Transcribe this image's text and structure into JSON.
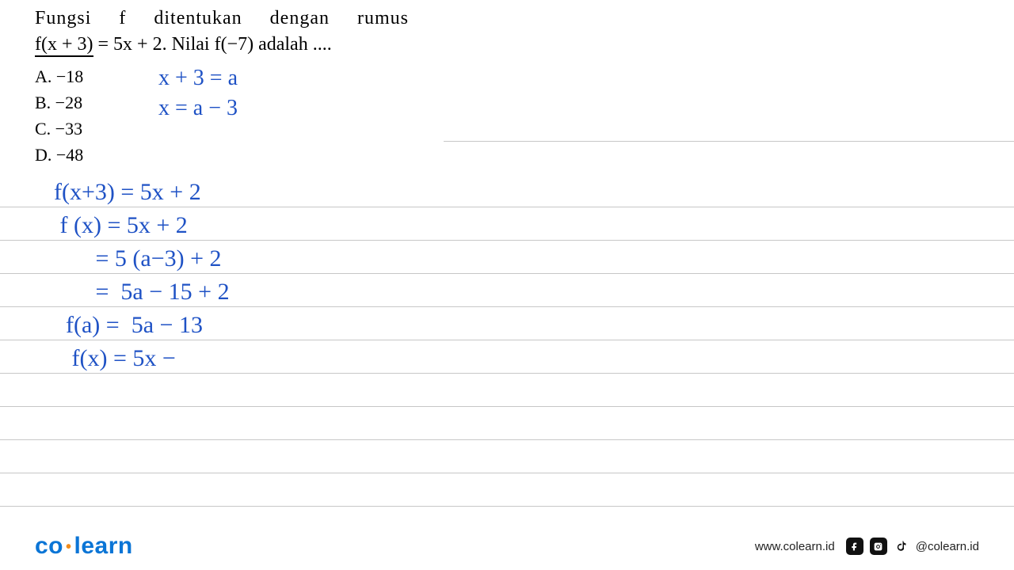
{
  "problem": {
    "line1_words": [
      "Fungsi",
      "f",
      "ditentukan",
      "dengan",
      "rumus"
    ],
    "line2_prefix": "f(x + 3)",
    "line2_rest": " = 5x + 2.  Nilai  f(−7)  adalah ....",
    "options": {
      "a": "A.  −18",
      "b": "B.  −28",
      "c": "C.  −33",
      "d": "D.  −48"
    }
  },
  "handwriting_top": {
    "l1": "x + 3 = a",
    "l2": "  x = a − 3"
  },
  "work": {
    "l1": "f(x+3) = 5x + 2",
    "l2": " f (x) = 5x + 2",
    "l3": "       = 5 (a−3) + 2",
    "l4": "       =  5a − 15 + 2",
    "l5": "  f(a) =  5a − 13",
    "l6": "   f(x) = 5x −"
  },
  "footer": {
    "brand_co": "co",
    "brand_learn": "learn",
    "url": "www.colearn.id",
    "handle": "@colearn.id"
  }
}
